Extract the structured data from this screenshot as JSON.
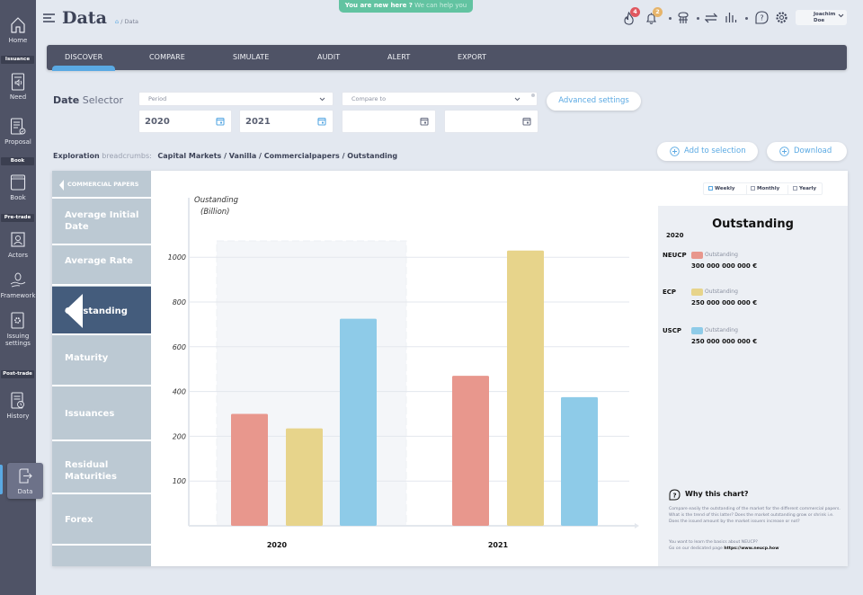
{
  "app": {
    "title": "Data",
    "breadcrumb": "/ Data",
    "new_here": {
      "bold": "You are new here ?",
      "link": "We can help you"
    }
  },
  "header": {
    "notifications": [
      {
        "icon": "fire-icon",
        "badge": "4",
        "badge_color": "#e0575f"
      },
      {
        "icon": "bell-icon",
        "badge": "2",
        "badge_color": "#e6b46a"
      }
    ],
    "user": {
      "first": "Joachim",
      "last": "Doe"
    }
  },
  "sidebar": {
    "items": [
      {
        "label": "Home"
      },
      {
        "section": "Issuance"
      },
      {
        "label": "Need"
      },
      {
        "label": "Proposal"
      },
      {
        "section": "Book"
      },
      {
        "label": "Book"
      },
      {
        "section": "Pre-trade"
      },
      {
        "label": "Actors"
      },
      {
        "label": "Framework"
      },
      {
        "label": "Issuing settings"
      },
      {
        "section": "Post-trade"
      },
      {
        "label": "History"
      },
      {
        "label": "Data",
        "active": true
      }
    ],
    "labels": {
      "home": "Home",
      "issuance": "Issuance",
      "need": "Need",
      "proposal": "Proposal",
      "book_section": "Book",
      "book": "Book",
      "pretrade": "Pre-trade",
      "actors": "Actors",
      "framework": "Framework",
      "issuing1": "Issuing",
      "issuing2": "settings",
      "posttrade": "Post-trade",
      "history": "History",
      "data": "Data"
    }
  },
  "tabs": [
    {
      "label": "DISCOVER",
      "active": true
    },
    {
      "label": "COMPARE"
    },
    {
      "label": "SIMULATE"
    },
    {
      "label": "AUDIT"
    },
    {
      "label": "ALERT"
    },
    {
      "label": "EXPORT"
    }
  ],
  "date_selector": {
    "label_bold": "Date",
    "label": "Selector",
    "period_placeholder": "Period",
    "from": "2020",
    "to": "2021",
    "compare_placeholder": "Compare to",
    "compare_from": "",
    "compare_to": "",
    "advanced": "Advanced settings"
  },
  "exploration": {
    "label_bold": "Exploration",
    "label": "breadcrumbs:",
    "path": "Capital Markets / Vanilla / Commercialpapers / Outstanding"
  },
  "actions": {
    "add": "Add to selection",
    "download": "Download"
  },
  "left_nav": {
    "header": "COMMERCIAL PAPERS",
    "items": [
      {
        "label1": "Average Initial",
        "label2": "Date"
      },
      {
        "label1": "Average Rate"
      },
      {
        "label1": "Outstanding",
        "active": true
      },
      {
        "label1": "Maturity"
      },
      {
        "label1": "Issuances"
      },
      {
        "label1": "Residual",
        "label2": "Maturities"
      },
      {
        "label1": "Forex"
      }
    ]
  },
  "frequency": {
    "options": [
      {
        "label": "Weekly",
        "checked": true
      },
      {
        "label": "Monthly",
        "checked": false
      },
      {
        "label": "Yearly",
        "checked": false
      }
    ]
  },
  "chart_data": {
    "type": "bar",
    "title": "",
    "ylabel": "Oustanding (Billion)",
    "xlabel": "",
    "categories": [
      "2020",
      "2021"
    ],
    "highlighted_category": "2020",
    "y_ticks": [
      100,
      200,
      400,
      600,
      800,
      1000
    ],
    "ylim": [
      0,
      1100
    ],
    "grid": true,
    "series": [
      {
        "name": "NEUCP",
        "color": "#e8978d",
        "values": [
          300,
          470
        ]
      },
      {
        "name": "ECP",
        "color": "#e7d48b",
        "values": [
          235,
          1030
        ]
      },
      {
        "name": "USCP",
        "color": "#8ecbe8",
        "values": [
          725,
          375
        ]
      }
    ]
  },
  "summary": {
    "title": "Outstanding",
    "year": "2020",
    "rows": [
      {
        "name": "NEUCP",
        "legend": "Outstanding",
        "amount": "300 000 000 000 €",
        "color": "#e8978d"
      },
      {
        "name": "ECP",
        "legend": "Outstanding",
        "amount": "250 000 000 000 €",
        "color": "#e7d48b"
      },
      {
        "name": "USCP",
        "legend": "Outstanding",
        "amount": "250 000 000 000 €",
        "color": "#8ecbe8"
      }
    ],
    "why_title": "Why this chart?",
    "why_lines": [
      "Compare easily the outstanding of the market for the different commercial papers.",
      "What is the trend of this latter? Does the market outstanding grow or shrink i.e.",
      "Does the issued amount by the market issuers increase or not?"
    ],
    "learn_line": "You want to learn the basics about NEUCP?",
    "goto_line": "Go on our dedicated page",
    "link": "https://www.neucp.how"
  }
}
